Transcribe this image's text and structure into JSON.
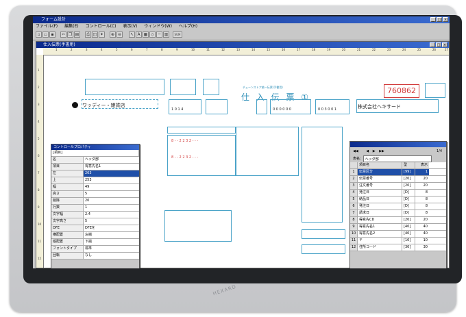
{
  "app": {
    "title": "フォーム設計",
    "window_buttons": [
      "_",
      "□",
      "×"
    ]
  },
  "menu": [
    "ファイル(F)",
    "編集(E)",
    "コントロール(C)",
    "表示(V)",
    "ウィンドウ(W)",
    "ヘルプ(H)"
  ],
  "toolbar": {
    "sum_label": "SUM"
  },
  "document": {
    "title": "仕入伝票(手書用)",
    "ruler_marks": [
      "1",
      "2",
      "3",
      "4",
      "5",
      "6",
      "7",
      "8",
      "9",
      "10",
      "11",
      "12",
      "13",
      "14",
      "15",
      "16",
      "17",
      "18",
      "19",
      "20",
      "21",
      "22",
      "23",
      "24",
      "25",
      "26",
      "27"
    ]
  },
  "form": {
    "subtitle": "チェーンストア統一伝票(手書用)",
    "title": "仕 入 伝 票 ①",
    "slip_number": "760862",
    "company": "株式会社ヘキサード",
    "store_name": "ワッディー・雑貨店",
    "code_a": "1 0 1 4",
    "code_b": "0 0 0 0 0 0",
    "code_c": "0 0 3 0 0 1"
  },
  "properties_panel": {
    "title": "コントロールプロパティ",
    "header": "[項目]",
    "rows": [
      {
        "k": "名",
        "v": "ヘッダ部"
      },
      {
        "k": "項目",
        "v": "得意先名1"
      },
      {
        "k": "左",
        "v": "263",
        "selected": true
      },
      {
        "k": "上",
        "v": "253"
      },
      {
        "k": "幅",
        "v": "49"
      },
      {
        "k": "高さ",
        "v": "5"
      },
      {
        "k": "削除",
        "v": "20"
      },
      {
        "k": "行数",
        "v": "1"
      },
      {
        "k": "文字幅",
        "v": "2.4"
      },
      {
        "k": "文字高さ",
        "v": "5"
      },
      {
        "k": "DFE",
        "v": "DFEを"
      },
      {
        "k": "横配置",
        "v": "左揃"
      },
      {
        "k": "縦配置",
        "v": "下揃"
      },
      {
        "k": "フォントタイプ",
        "v": "標準"
      },
      {
        "k": "回転",
        "v": "なし"
      }
    ]
  },
  "list_panel": {
    "nav": "1/4",
    "group_label": "表名:",
    "group_value": "ヘッダ部",
    "columns": [
      "項目名",
      "型",
      "表示"
    ],
    "rows": [
      {
        "n": "1",
        "name": "伝票区分",
        "type": "[99]",
        "len": "1",
        "selected": true
      },
      {
        "n": "2",
        "name": "伝票番号",
        "type": "[20]",
        "len": "20"
      },
      {
        "n": "3",
        "name": "注文番号",
        "type": "[20]",
        "len": "20"
      },
      {
        "n": "4",
        "name": "発注日",
        "type": "[D]",
        "len": "8"
      },
      {
        "n": "5",
        "name": "納品日",
        "type": "[D]",
        "len": "8"
      },
      {
        "n": "6",
        "name": "発注日",
        "type": "[D]",
        "len": "8"
      },
      {
        "n": "7",
        "name": "請求日",
        "type": "[D]",
        "len": "8"
      },
      {
        "n": "8",
        "name": "得意先CD",
        "type": "[20]",
        "len": "20"
      },
      {
        "n": "9",
        "name": "得意先名1",
        "type": "[40]",
        "len": "40"
      },
      {
        "n": "10",
        "name": "得意先名2",
        "type": "[40]",
        "len": "40"
      },
      {
        "n": "11",
        "name": "〒",
        "type": "[10]",
        "len": "10"
      },
      {
        "n": "12",
        "name": "住所コード",
        "type": "[30]",
        "len": "30"
      }
    ]
  },
  "device": {
    "brand": "HEXARD"
  }
}
